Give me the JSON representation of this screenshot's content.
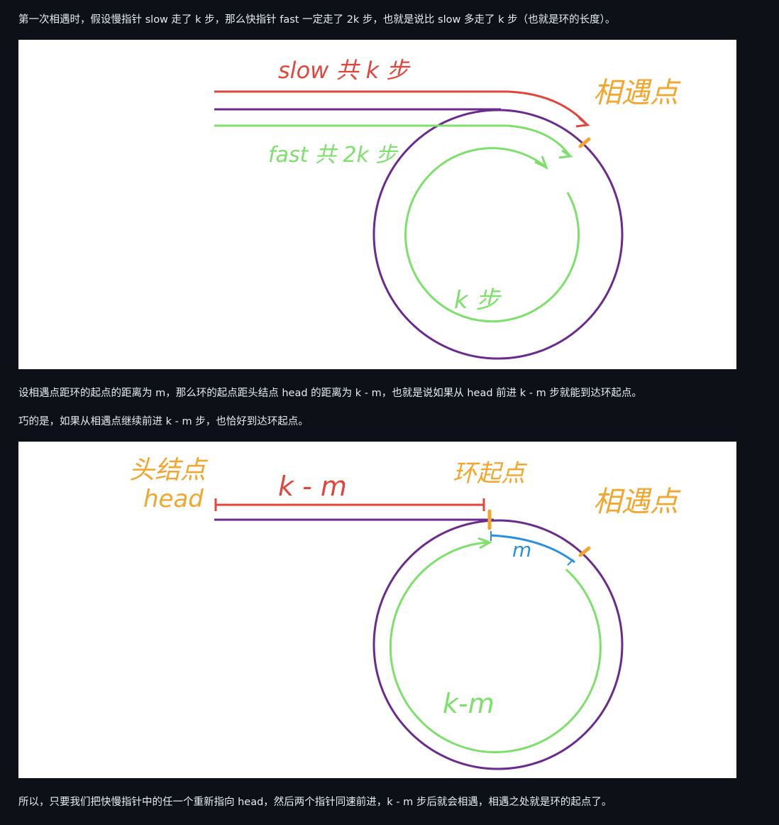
{
  "paragraphs": {
    "p1": "第一次相遇时，假设慢指针 slow 走了 k 步，那么快指针 fast 一定走了 2k 步，也就是说比 slow 多走了 k 步（也就是环的长度）。",
    "p2": "设相遇点距环的起点的距离为 m，那么环的起点距头结点 head 的距离为 k - m，也就是说如果从 head 前进 k - m 步就能到达环起点。",
    "p3": "巧的是，如果从相遇点继续前进 k - m 步，也恰好到达环起点。",
    "p4": "所以，只要我们把快慢指针中的任一个重新指向 head，然后两个指针同速前进，k - m 步后就会相遇，相遇之处就是环的起点了。"
  },
  "figure1": {
    "slow_label": "slow 共 k 步",
    "fast_label": "fast 共 2k 步",
    "meet_label": "相遇点",
    "loop_label": "k 步"
  },
  "figure2": {
    "head_label_1": "头结点",
    "head_label_2": "head",
    "km_top_label": "k - m",
    "ring_start_label": "环起点",
    "meet_label": "相遇点",
    "m_label": "m",
    "km_loop_label": "k-m"
  },
  "colors": {
    "background": "#0d1117",
    "text": "#e6edf3",
    "red": "#e2453c",
    "purple": "#6a2a8e",
    "green": "#7ce06a",
    "orange": "#f4a52c",
    "blue": "#2b8fe0"
  }
}
